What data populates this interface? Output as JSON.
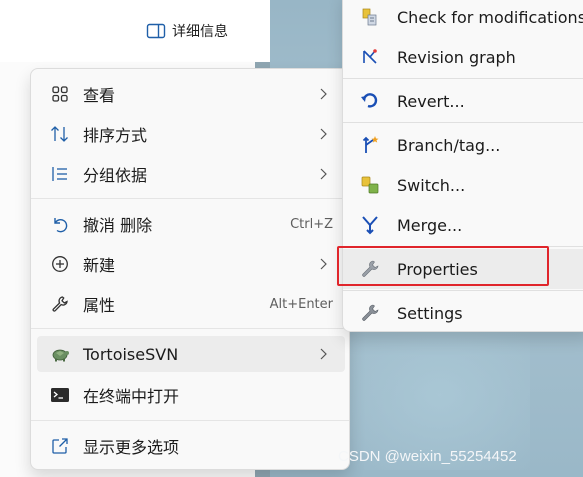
{
  "explorer": {
    "details_label": "详细信息"
  },
  "menu": {
    "items": [
      {
        "label": "查看",
        "icon": "grid-icon",
        "has_submenu": true
      },
      {
        "label": "排序方式",
        "icon": "sort-arrows-icon",
        "has_submenu": true
      },
      {
        "label": "分组依据",
        "icon": "list-group-icon",
        "has_submenu": true
      },
      {
        "label": "撤消 删除",
        "icon": "undo-icon",
        "shortcut": "Ctrl+Z"
      },
      {
        "label": "新建",
        "icon": "plus-circle-icon",
        "has_submenu": true
      },
      {
        "label": "属性",
        "icon": "wrench-icon",
        "shortcut": "Alt+Enter"
      },
      {
        "label": "TortoiseSVN",
        "icon": "tortoise-icon",
        "has_submenu": true,
        "highlighted": true
      },
      {
        "label": "在终端中打开",
        "icon": "terminal-icon"
      },
      {
        "label": "显示更多选项",
        "icon": "share-out-icon"
      }
    ]
  },
  "submenu": {
    "items": [
      {
        "label": "Check for modifications",
        "icon": "check-modifications-icon"
      },
      {
        "label": "Revision graph",
        "icon": "revision-graph-icon"
      },
      {
        "label": "Revert...",
        "icon": "revert-icon"
      },
      {
        "label": "Branch/tag...",
        "icon": "branch-tag-icon"
      },
      {
        "label": "Switch...",
        "icon": "switch-icon"
      },
      {
        "label": "Merge...",
        "icon": "merge-icon"
      },
      {
        "label": "Properties",
        "icon": "properties-wrench-icon",
        "highlighted": true
      },
      {
        "label": "Settings",
        "icon": "settings-wrench-icon"
      }
    ]
  },
  "watermark": "CSDN @weixin_55254452",
  "colors": {
    "highlight_box": "#e0252b",
    "accent_blue": "#1a6fc9"
  }
}
